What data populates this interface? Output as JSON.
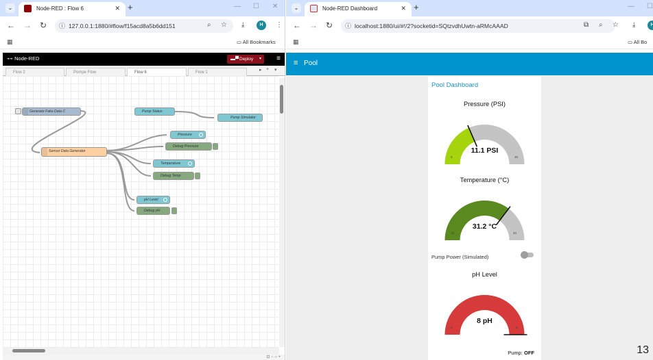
{
  "left": {
    "tab_title": "Node-RED : Flow 6",
    "url": "127.0.0.1:1880/#flow/f15acd8a5b6dd151",
    "profile_initial": "H",
    "all_bookmarks": "All Bookmarks",
    "nr_title": "Node-RED",
    "deploy_label": "Deploy",
    "flow_tabs": [
      "Flow 2",
      "Pompe Flow",
      "Flow 6",
      "Flow 1"
    ],
    "nodes": {
      "generate": "Generate Fake Data C",
      "sensor": "Sensor Data Generator",
      "pump_status": "Pump Status",
      "pump_sim": "Pump Simulator",
      "pressure": "Pressure",
      "debug_pressure": "Debug Pressure",
      "temperature": "Temperature",
      "debug_temp": "Debug Temp",
      "ph": "pH Level",
      "debug_ph": "Debug pH"
    }
  },
  "right": {
    "tab_title": "Node-RED Dashboard",
    "url": "localhost:1880/ui/#!/2?socketid=SQtzvdhUwtn-aRMcAAAD",
    "all_bookmarks": "All Bo",
    "header_title": "Pool",
    "group_title": "Pool Dashboard",
    "gauges": [
      {
        "title": "Pressure (PSI)",
        "value": 11.1,
        "display": "11.1 PSI",
        "min": "0",
        "max": "30",
        "color": "#a6d40c"
      },
      {
        "title": "Temperature (°C)",
        "value": 31.2,
        "display": "31.2 °C",
        "min": "10",
        "max": "40",
        "color": "#5a8a1f"
      },
      {
        "title": "pH Level",
        "value": 8,
        "display": "8 pH",
        "min": "6",
        "max": "8",
        "color": "#d63a3a"
      }
    ],
    "switch_label": "Pump Power (Simulated)",
    "pump_label": "Pump:",
    "pump_state": "OFF"
  },
  "page_number": "13",
  "colors": {
    "tabstrip": "#d3e3fd",
    "nr_header": "#000000",
    "deploy": "#8c101c",
    "dashboard_header": "#0094ce",
    "group_title": "#1b93c9",
    "gauge_bg": "#c4c4c4"
  }
}
